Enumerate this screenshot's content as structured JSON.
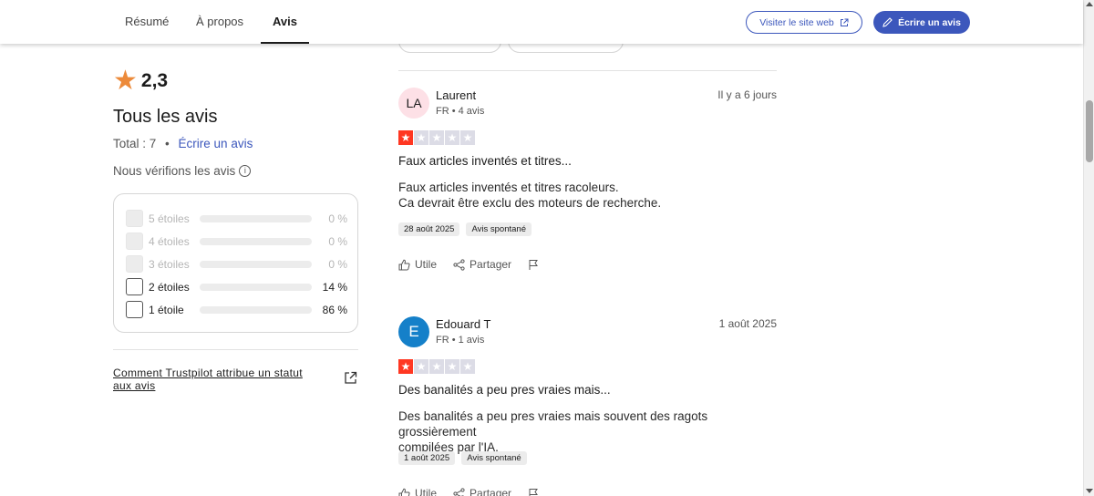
{
  "header": {
    "tabs": [
      "Résumé",
      "À propos",
      "Avis"
    ],
    "visit_label": "Visiter le site web",
    "write_label": "Écrire un avis"
  },
  "summary": {
    "score": "2,3",
    "heading": "Tous les avis",
    "total": "Total : 7",
    "separator": "•",
    "write_link": "Écrire un avis",
    "verify": "Nous vérifions les avis",
    "info_glyph": "i"
  },
  "distribution": [
    {
      "label": "5 étoiles",
      "percent_text": "0 %",
      "fraction": 0.0,
      "enabled": false
    },
    {
      "label": "4 étoiles",
      "percent_text": "0 %",
      "fraction": 0.0,
      "enabled": false
    },
    {
      "label": "3 étoiles",
      "percent_text": "0 %",
      "fraction": 0.0,
      "enabled": false
    },
    {
      "label": "2 étoiles",
      "percent_text": "14 %",
      "fraction": 0.14,
      "enabled": true
    },
    {
      "label": "1 étoile",
      "percent_text": "86 %",
      "fraction": 0.86,
      "enabled": true
    }
  ],
  "how_link": "Comment Trustpilot attribue un statut aux avis",
  "reviews": [
    {
      "initials": "LA",
      "name": "Laurent",
      "meta": "FR • 4 avis",
      "date": "Il y a 6 jours",
      "rating": 1,
      "title": "Faux articles inventés et titres...",
      "body_lines": [
        "Faux articles inventés et titres racoleurs.",
        "Ca devrait être exclu des moteurs de recherche."
      ],
      "tags": [
        "28 août 2025",
        "Avis spontané"
      ]
    },
    {
      "initials": "E",
      "name": "Edouard T",
      "meta": "FR • 1 avis",
      "date": "1 août 2025",
      "rating": 1,
      "title": "Des banalités a peu pres vraies mais...",
      "body_lines": [
        "Des banalités a peu pres vraies mais souvent des ragots grossièrement",
        "compilées par l'IA."
      ],
      "tags": [
        "1 août 2025",
        "Avis spontané"
      ]
    }
  ],
  "actions": {
    "useful": "Utile",
    "share": "Partager"
  },
  "colors": {
    "accent": "#3c57bc",
    "star_on": "#ff3722",
    "star_off": "#dcdce6",
    "score_star": "#ec8a3a"
  }
}
